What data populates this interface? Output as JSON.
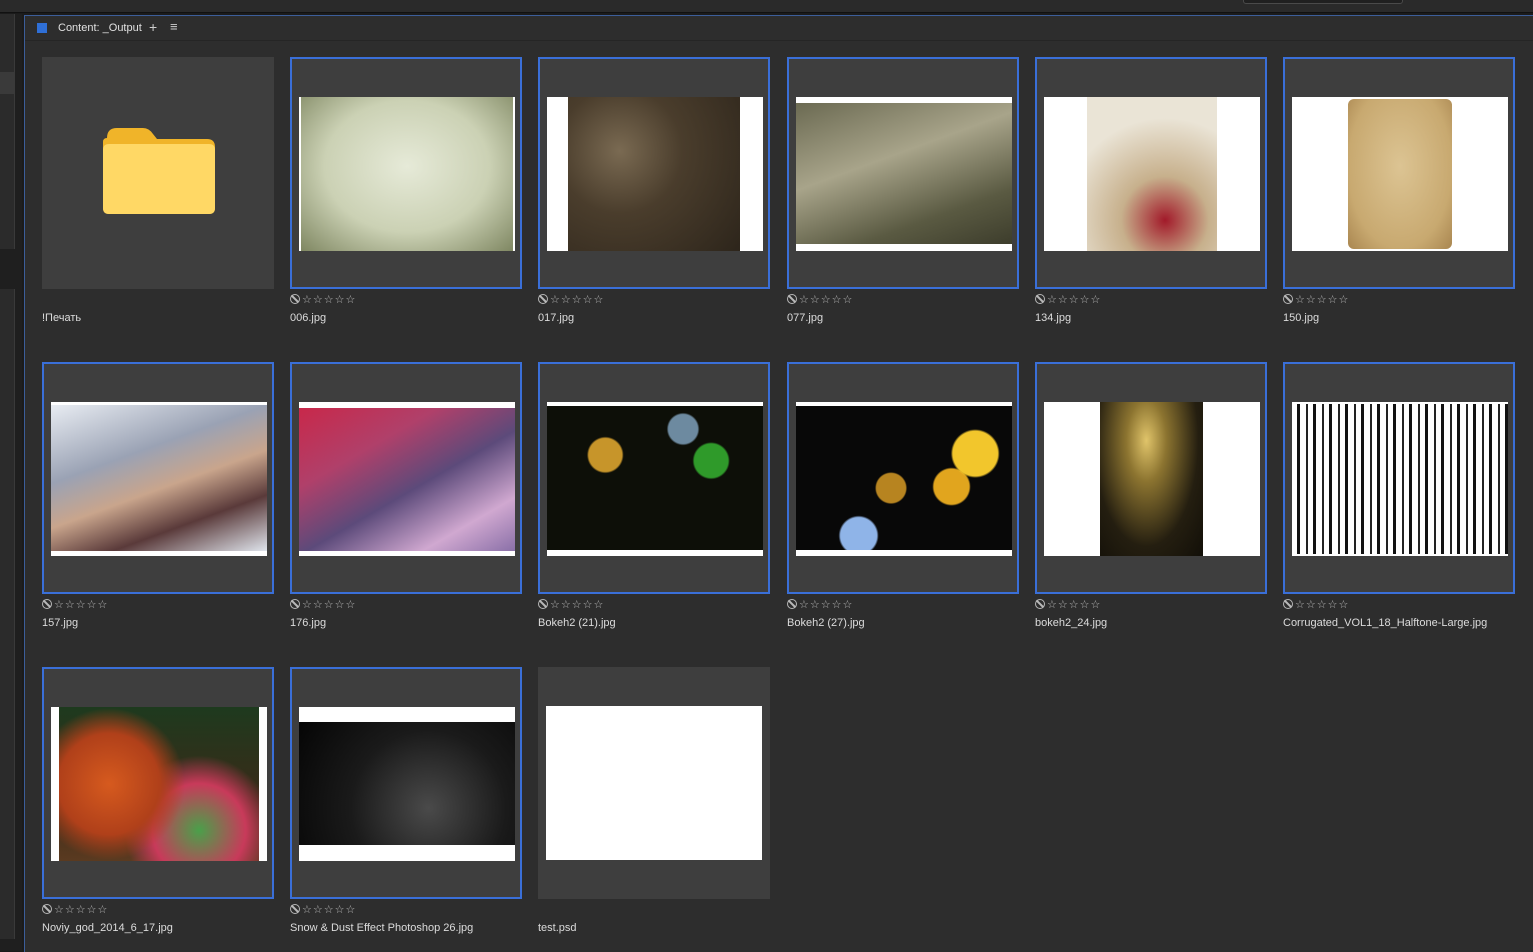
{
  "panel": {
    "title": "Content: _Output",
    "add_label": "+",
    "menu_label": "≡"
  },
  "rating": {
    "reject_icon": "reject-icon",
    "stars": "☆☆☆☆☆"
  },
  "items": [
    {
      "name": "!Печать",
      "type": "folder",
      "selected": false,
      "rated": false
    },
    {
      "name": "006.jpg",
      "type": "image",
      "selected": true,
      "rated": true
    },
    {
      "name": "017.jpg",
      "type": "image",
      "selected": true,
      "rated": true
    },
    {
      "name": "077.jpg",
      "type": "image",
      "selected": true,
      "rated": true
    },
    {
      "name": "134.jpg",
      "type": "image",
      "selected": true,
      "rated": true
    },
    {
      "name": "150.jpg",
      "type": "image",
      "selected": true,
      "rated": true
    },
    {
      "name": "157.jpg",
      "type": "image",
      "selected": true,
      "rated": true
    },
    {
      "name": "176.jpg",
      "type": "image",
      "selected": true,
      "rated": true
    },
    {
      "name": "Bokeh2 (21).jpg",
      "type": "image",
      "selected": true,
      "rated": true
    },
    {
      "name": "Bokeh2 (27).jpg",
      "type": "image",
      "selected": true,
      "rated": true
    },
    {
      "name": "bokeh2_24.jpg",
      "type": "image",
      "selected": true,
      "rated": true
    },
    {
      "name": "Corrugated_VOL1_18_Halftone-Large.jpg",
      "type": "image",
      "selected": true,
      "rated": true
    },
    {
      "name": "Noviy_god_2014_6_17.jpg",
      "type": "image",
      "selected": true,
      "rated": true
    },
    {
      "name": "Snow & Dust Effect Photoshop 26.jpg",
      "type": "image",
      "selected": true,
      "rated": true
    },
    {
      "name": "test.psd",
      "type": "image",
      "selected": false,
      "rated": false
    }
  ]
}
